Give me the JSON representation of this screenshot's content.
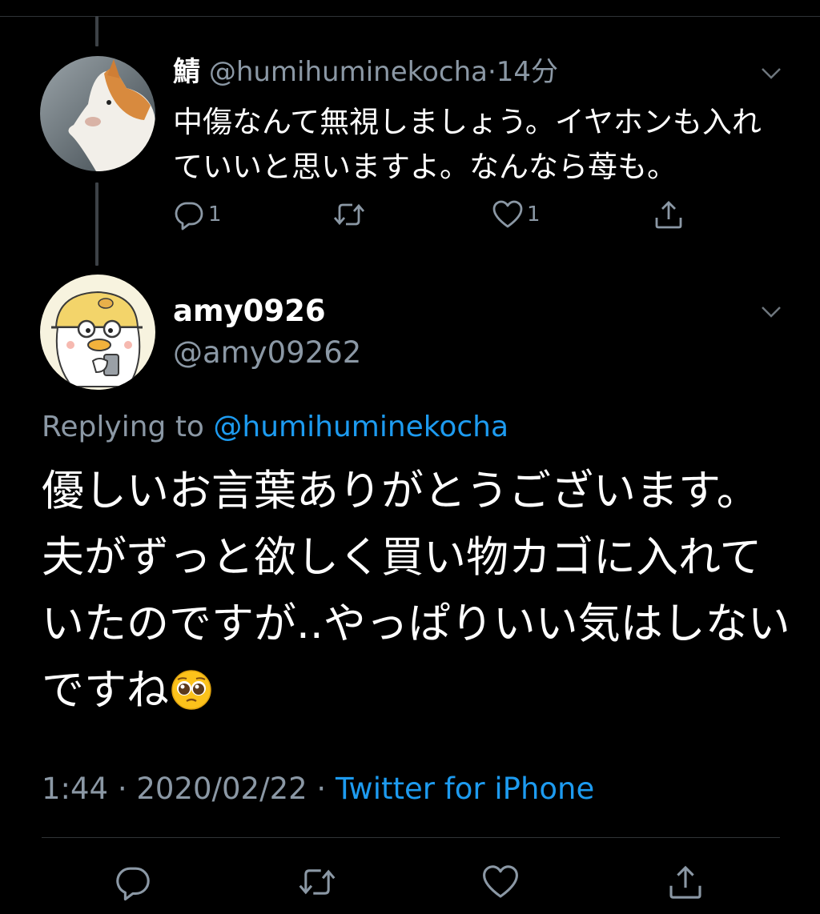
{
  "parent_tweet": {
    "display_name": "鯖",
    "handle": "@humihuminekocha",
    "separator": "·",
    "time": "14分",
    "text": "中傷なんて無視しましょう。イヤホンも入れていいと思いますよ。なんなら苺も。",
    "reply_count": "1",
    "like_count": "1",
    "icons": [
      "reply-icon",
      "retweet-icon",
      "like-icon",
      "share-icon",
      "chevron-down-icon"
    ]
  },
  "main_tweet": {
    "display_name": "amy0926",
    "handle": "@amy09262",
    "replying_prefix": "Replying to",
    "replying_handle": "@humihuminekocha",
    "text": "優しいお言葉ありがとうございます。夫がずっと欲しく買い物カゴに入れていたのですが..やっぱりいい気はしないですね",
    "emoji": "pleading-face",
    "time": "1:44",
    "date": "2020/02/22",
    "dot": "·",
    "source": "Twitter for iPhone",
    "icons": [
      "reply-icon",
      "retweet-icon",
      "like-icon",
      "share-icon",
      "chevron-down-icon"
    ]
  },
  "colors": {
    "background": "#000000",
    "text": "#ffffff",
    "muted": "#8b98a5",
    "link": "#1d9bf0",
    "divider": "#2f3336"
  }
}
